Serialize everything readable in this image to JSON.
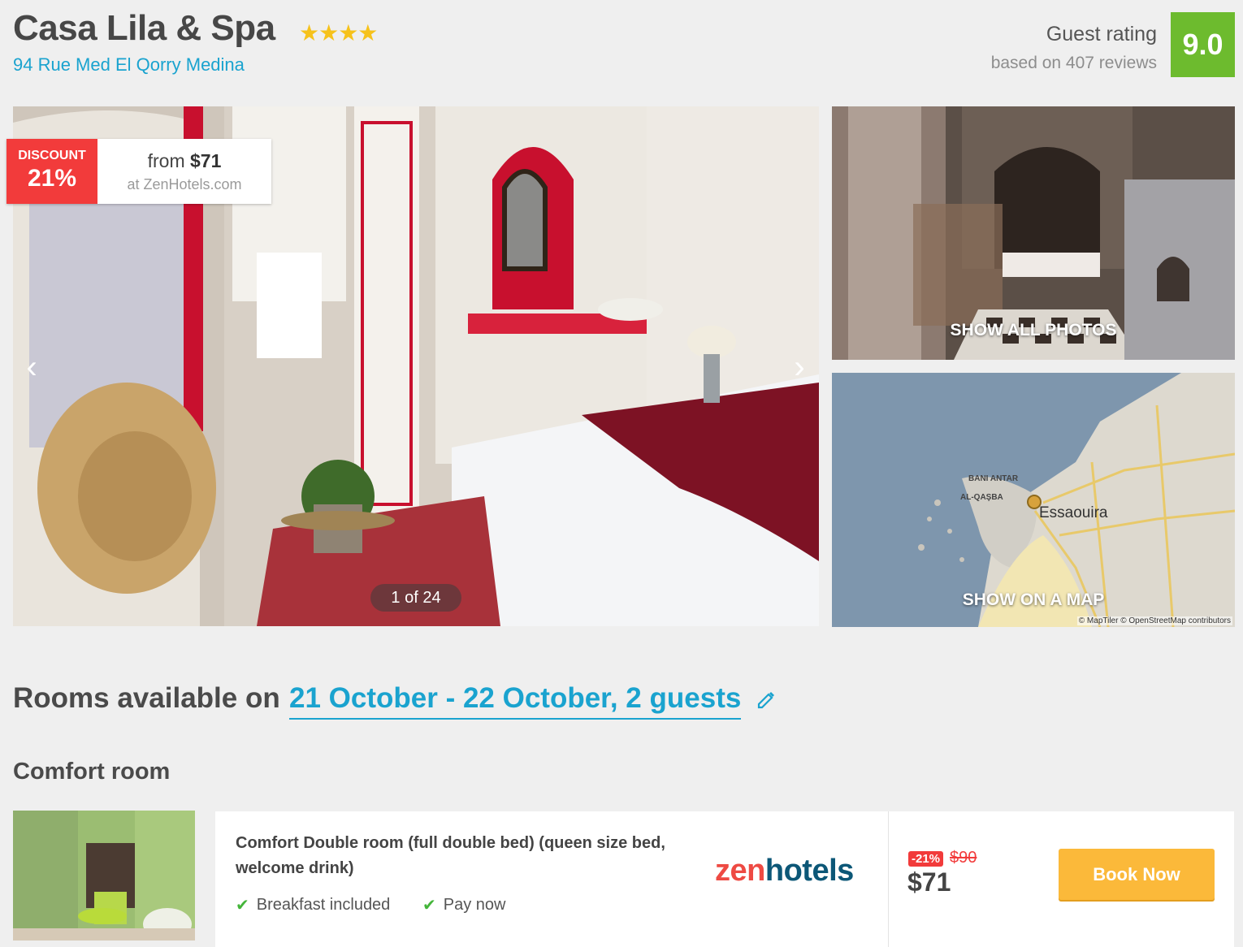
{
  "hotel": {
    "name": "Casa Lila & Spa",
    "stars": "★★★★",
    "address": "94 Rue Med El Qorry Medina"
  },
  "rating": {
    "label": "Guest rating",
    "sub": "based on 407 reviews",
    "score": "9.0"
  },
  "gallery": {
    "discount_label": "DISCOUNT",
    "discount_value": "21%",
    "price_prefix": "from ",
    "price": "$71",
    "price_source": "at ZenHotels.com",
    "prev_arrow": "‹",
    "next_arrow": "›",
    "counter": "1 of 24",
    "show_all_photos": "SHOW ALL PHOTOS",
    "show_on_map": "SHOW ON A MAP"
  },
  "map": {
    "label_bani_antar": "BANI ANTAR",
    "label_al_qasba": "AL-QAŞBA",
    "city": "Essaouira",
    "attribution": "© MapTiler © OpenStreetMap contributors"
  },
  "rooms": {
    "heading": "Rooms available on",
    "dates": "21 October - 22 October, 2 guests",
    "room_type": "Comfort room"
  },
  "offer": {
    "name": "Comfort Double room (full double bed) (queen size bed, welcome drink)",
    "amenities": [
      "Breakfast included",
      "Pay now"
    ],
    "provider_part1": "zen",
    "provider_part2": "hotels",
    "discount": "-21%",
    "old_price": "$90",
    "price": "$71",
    "book_label": "Book Now"
  },
  "colors": {
    "accent_blue": "#1aa3cf",
    "rating_green": "#6dbb2e",
    "discount_red": "#f23b3b",
    "book_orange": "#fbb93a"
  }
}
